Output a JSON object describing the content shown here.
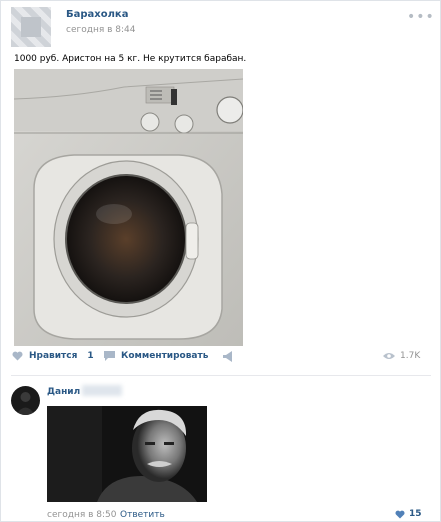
{
  "post": {
    "group_name": "Барахолка",
    "time": "сегодня в 8:44",
    "more_icon": "more-dots-icon",
    "text": "1000 руб. Аристон на 5 кг. Не крутится барабан.",
    "photo": "washing-machine-photo"
  },
  "actions": {
    "like_label": "Нравится",
    "like_count": "1",
    "comment_label": "Комментировать",
    "share_icon": "share-megaphone-icon",
    "views_count": "1.7K",
    "views_icon": "eye-icon"
  },
  "comment": {
    "author_name": "Данил",
    "time": "сегодня в 8:50",
    "reply_label": "Ответить",
    "likes_count": "15",
    "photo": "elderly-man-photo"
  },
  "colors": {
    "link": "#2a5885",
    "muted": "#939393",
    "divider": "#e7e8ec"
  }
}
